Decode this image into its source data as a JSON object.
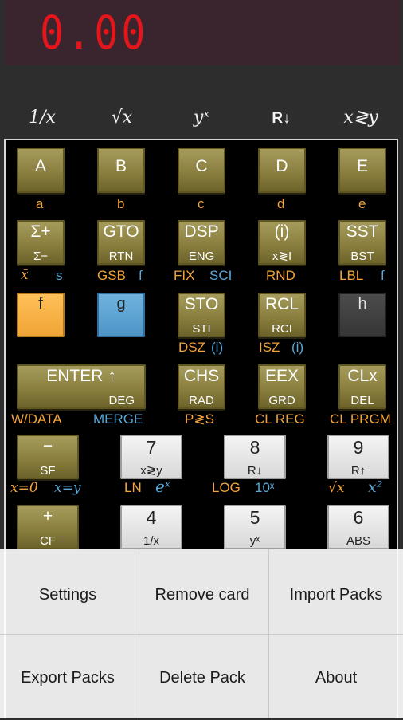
{
  "display": {
    "readout": "0.00"
  },
  "top_row": [
    "1/x",
    "√x",
    "yˣ",
    "R↓",
    "x≷y"
  ],
  "rows": {
    "r1": {
      "keys": [
        {
          "main": "A",
          "sub": ""
        },
        {
          "main": "B",
          "sub": ""
        },
        {
          "main": "C",
          "sub": ""
        },
        {
          "main": "D",
          "sub": ""
        },
        {
          "main": "E",
          "sub": ""
        }
      ],
      "labels": [
        "a",
        "b",
        "c",
        "d",
        "e"
      ]
    },
    "r2": {
      "keys": [
        {
          "main": "Σ+",
          "sub": "Σ−"
        },
        {
          "main": "GTO",
          "sub": "RTN"
        },
        {
          "main": "DSP",
          "sub": "ENG"
        },
        {
          "main": "(i)",
          "sub": "x≷I"
        },
        {
          "main": "SST",
          "sub": "BST"
        }
      ],
      "labels": {
        "x_bar": "x̄",
        "s": "s",
        "gsb": "GSB",
        "f1": "f",
        "fix": "FIX",
        "sci": "SCI",
        "rnd": "RND",
        "lbl": "LBL",
        "f2": "f"
      }
    },
    "r3": {
      "keys": [
        {
          "main": "f",
          "sub": ""
        },
        {
          "main": "g",
          "sub": ""
        },
        {
          "main": "STO",
          "sub": "STI"
        },
        {
          "main": "RCL",
          "sub": "RCI"
        },
        {
          "main": "h",
          "sub": ""
        }
      ],
      "labels": {
        "dsz": "DSZ",
        "dsz_i": "(i)",
        "isz": "ISZ",
        "isz_i": "(i)"
      }
    },
    "r4": {
      "keys": [
        {
          "main": "ENTER ↑",
          "sub": "DEG"
        },
        {
          "main": "CHS",
          "sub": "RAD"
        },
        {
          "main": "EEX",
          "sub": "GRD"
        },
        {
          "main": "CLx",
          "sub": "DEL"
        }
      ],
      "labels": {
        "wdata": "W/DATA",
        "merge": "MERGE",
        "pcs": "P≷S",
        "clreg": "CL REG",
        "clprgm": "CL PRGM"
      }
    },
    "r5": {
      "keys": [
        {
          "main": "−",
          "sub": "SF"
        },
        {
          "main": "7",
          "sub": "x≷y"
        },
        {
          "main": "8",
          "sub": "R↓"
        },
        {
          "main": "9",
          "sub": "R↑"
        }
      ],
      "labels": {
        "x0": "x=0",
        "xy": "x=y",
        "ln": "LN",
        "ex": "eˣ",
        "log": "LOG",
        "tenx": "10ˣ",
        "sqrt": "√x",
        "x2": "x²"
      }
    },
    "r6": {
      "keys": [
        {
          "main": "+",
          "sub": "CF"
        },
        {
          "main": "4",
          "sub": "1/x"
        },
        {
          "main": "5",
          "sub": "yˣ"
        },
        {
          "main": "6",
          "sub": "ABS"
        }
      ]
    }
  },
  "menu": {
    "settings": "Settings",
    "remove_card": "Remove card",
    "import_packs": "Import Packs",
    "export_packs": "Export Packs",
    "delete_pack": "Delete Pack",
    "about": "About"
  },
  "colors": {
    "display_bg": "#3a252e",
    "digits": "#e4151b",
    "olive_key": "#8a7f3f",
    "f_key": "#f0a334",
    "g_key": "#4b94c6",
    "f_label": "#f4a43a",
    "g_label": "#5aa7d8"
  }
}
